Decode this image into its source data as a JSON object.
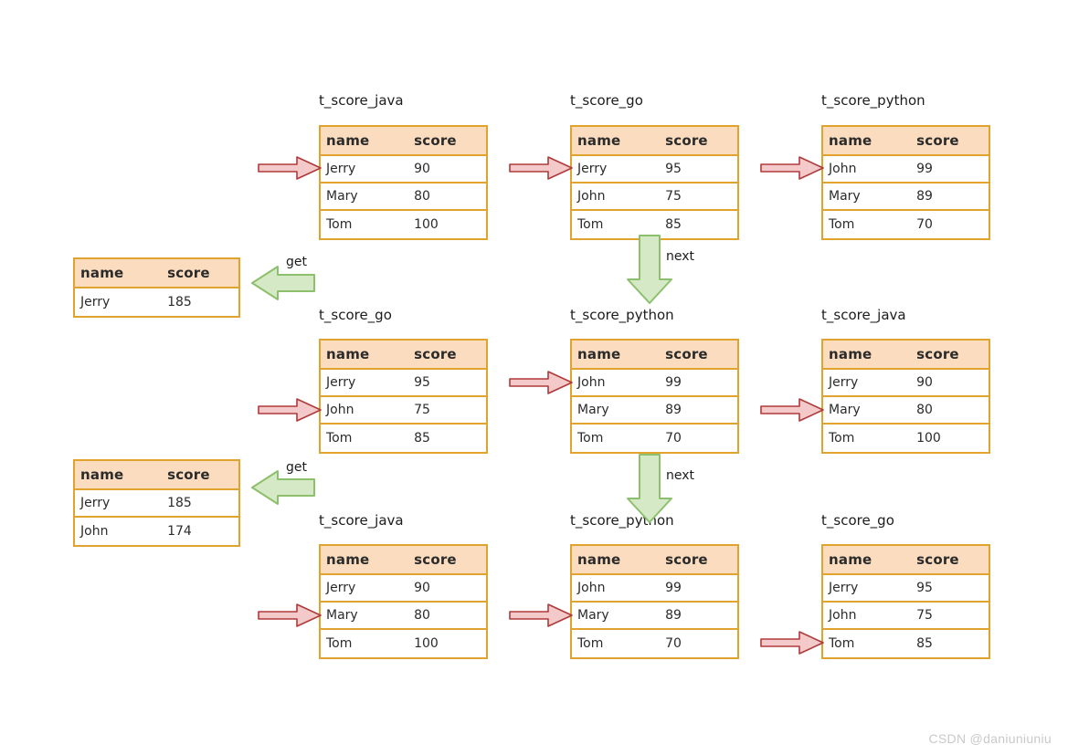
{
  "diagram": {
    "columns": {
      "name_header": "name",
      "score_header": "score"
    },
    "watermark": "CSDN @daniuniuniu",
    "labels": {
      "get": "get",
      "next": "next"
    }
  },
  "tables": {
    "r1c1": {
      "title": "t_score_java",
      "headers": {
        "name": "name",
        "score": "score"
      },
      "rows": [
        {
          "name": "Jerry",
          "score": "90"
        },
        {
          "name": "Mary",
          "score": "80"
        },
        {
          "name": "Tom",
          "score": "100"
        }
      ]
    },
    "r1c2": {
      "title": "t_score_go",
      "headers": {
        "name": "name",
        "score": "score"
      },
      "rows": [
        {
          "name": "Jerry",
          "score": "95"
        },
        {
          "name": "John",
          "score": "75"
        },
        {
          "name": "Tom",
          "score": "85"
        }
      ]
    },
    "r1c3": {
      "title": "t_score_python",
      "headers": {
        "name": "name",
        "score": "score"
      },
      "rows": [
        {
          "name": "John",
          "score": "99"
        },
        {
          "name": "Mary",
          "score": "89"
        },
        {
          "name": "Tom",
          "score": "70"
        }
      ]
    },
    "r2c1": {
      "title": "t_score_go",
      "headers": {
        "name": "name",
        "score": "score"
      },
      "rows": [
        {
          "name": "Jerry",
          "score": "95"
        },
        {
          "name": "John",
          "score": "75"
        },
        {
          "name": "Tom",
          "score": "85"
        }
      ]
    },
    "r2c2": {
      "title": "t_score_python",
      "headers": {
        "name": "name",
        "score": "score"
      },
      "rows": [
        {
          "name": "John",
          "score": "99"
        },
        {
          "name": "Mary",
          "score": "89"
        },
        {
          "name": "Tom",
          "score": "70"
        }
      ]
    },
    "r2c3": {
      "title": "t_score_java",
      "headers": {
        "name": "name",
        "score": "score"
      },
      "rows": [
        {
          "name": "Jerry",
          "score": "90"
        },
        {
          "name": "Mary",
          "score": "80"
        },
        {
          "name": "Tom",
          "score": "100"
        }
      ]
    },
    "r3c1": {
      "title": "t_score_java",
      "headers": {
        "name": "name",
        "score": "score"
      },
      "rows": [
        {
          "name": "Jerry",
          "score": "90"
        },
        {
          "name": "Mary",
          "score": "80"
        },
        {
          "name": "Tom",
          "score": "100"
        }
      ]
    },
    "r3c2": {
      "title": "t_score_python",
      "headers": {
        "name": "name",
        "score": "score"
      },
      "rows": [
        {
          "name": "John",
          "score": "99"
        },
        {
          "name": "Mary",
          "score": "89"
        },
        {
          "name": "Tom",
          "score": "70"
        }
      ]
    },
    "r3c3": {
      "title": "t_score_go",
      "headers": {
        "name": "name",
        "score": "score"
      },
      "rows": [
        {
          "name": "Jerry",
          "score": "95"
        },
        {
          "name": "John",
          "score": "75"
        },
        {
          "name": "Tom",
          "score": "85"
        }
      ]
    },
    "result1": {
      "headers": {
        "name": "name",
        "score": "score"
      },
      "rows": [
        {
          "name": "Jerry",
          "score": "185"
        }
      ]
    },
    "result2": {
      "headers": {
        "name": "name",
        "score": "score"
      },
      "rows": [
        {
          "name": "Jerry",
          "score": "185"
        },
        {
          "name": "John",
          "score": "174"
        }
      ]
    }
  },
  "colors": {
    "table_border": "#E0A32E",
    "header_fill": "#FBDCBE",
    "red_arrow_fill": "#F3C9C9",
    "red_arrow_stroke": "#B03A3A",
    "green_arrow_fill": "#D6E9C6",
    "green_arrow_stroke": "#8CC06C",
    "watermark": "#C9C9C9"
  }
}
